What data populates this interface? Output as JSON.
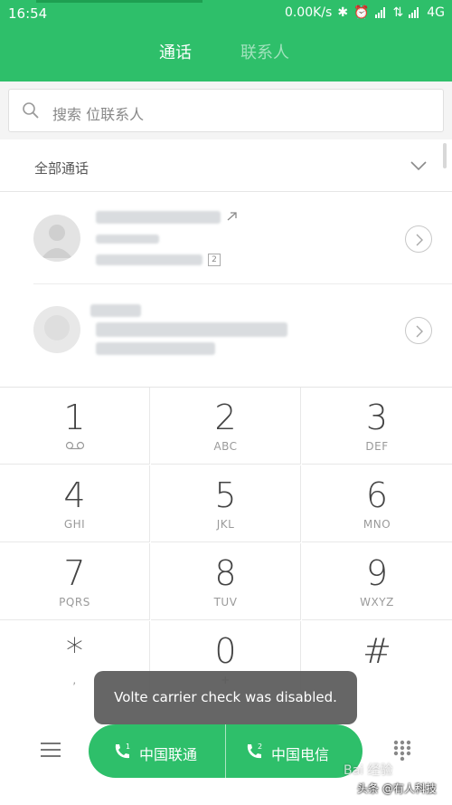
{
  "status_bar": {
    "time": "16:54",
    "network_speed": "0.00K/s",
    "network_type": "4G"
  },
  "tabs": [
    {
      "label": "通话",
      "active": true
    },
    {
      "label": "联系人",
      "active": false
    }
  ],
  "search": {
    "placeholder": "搜索 位联系人"
  },
  "filter": {
    "label": "全部通话"
  },
  "keypad": [
    {
      "digit": "1",
      "letters": ""
    },
    {
      "digit": "2",
      "letters": "ABC"
    },
    {
      "digit": "3",
      "letters": "DEF"
    },
    {
      "digit": "4",
      "letters": "GHI"
    },
    {
      "digit": "5",
      "letters": "JKL"
    },
    {
      "digit": "6",
      "letters": "MNO"
    },
    {
      "digit": "7",
      "letters": "PQRS"
    },
    {
      "digit": "8",
      "letters": "TUV"
    },
    {
      "digit": "9",
      "letters": "WXYZ"
    },
    {
      "digit": "*",
      "letters": ","
    },
    {
      "digit": "0",
      "letters": "+"
    },
    {
      "digit": "#",
      "letters": ""
    }
  ],
  "call_buttons": [
    {
      "sim": "1",
      "label": "中国联通"
    },
    {
      "sim": "2",
      "label": "中国电信"
    }
  ],
  "toast": {
    "message": "Volte carrier check was disabled."
  },
  "watermark": {
    "text": "头条 @有人科技"
  },
  "colors": {
    "accent": "#2ebf6a",
    "toast_bg": "#5a5a5a"
  }
}
